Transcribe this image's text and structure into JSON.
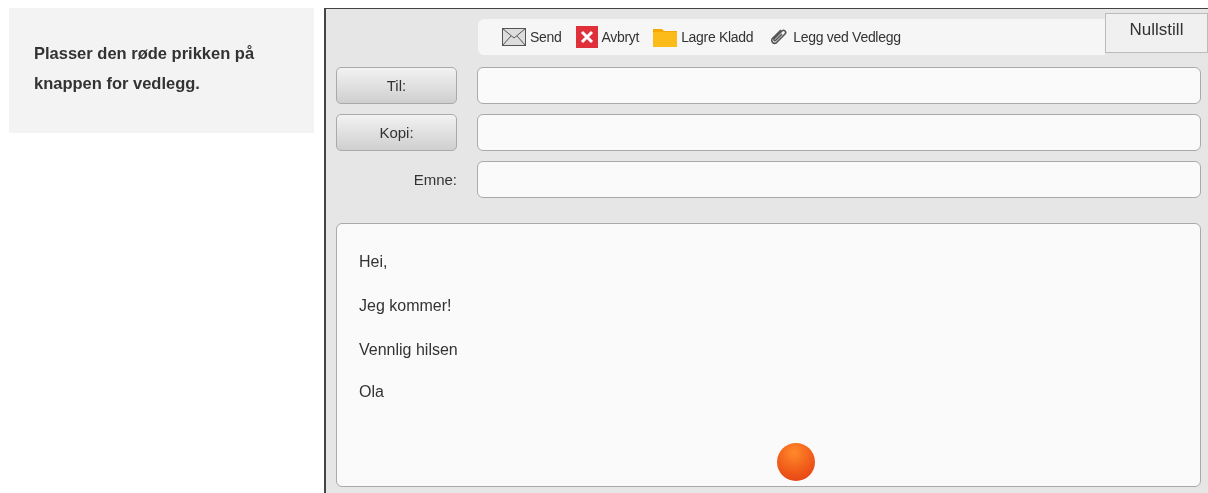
{
  "instruction": "Plasser den røde prikken på knappen for vedlegg.",
  "toolbar": [
    {
      "kind": "send",
      "label": "Send"
    },
    {
      "kind": "cancel",
      "label": "Avbryt"
    },
    {
      "kind": "draft",
      "label": "Lagre Kladd"
    },
    {
      "kind": "attach",
      "label": "Legg ved Vedlegg"
    }
  ],
  "reset_button": "Nullstill",
  "fields": [
    {
      "kind": "button",
      "label": "Til:"
    },
    {
      "kind": "button",
      "label": "Kopi:"
    },
    {
      "kind": "label",
      "label": "Emne:"
    }
  ],
  "message": {
    "paragraphs": [
      [
        "Hei,"
      ],
      [
        "Jeg kommer!"
      ],
      [
        "Vennlig hilsen",
        "Ola"
      ]
    ]
  }
}
